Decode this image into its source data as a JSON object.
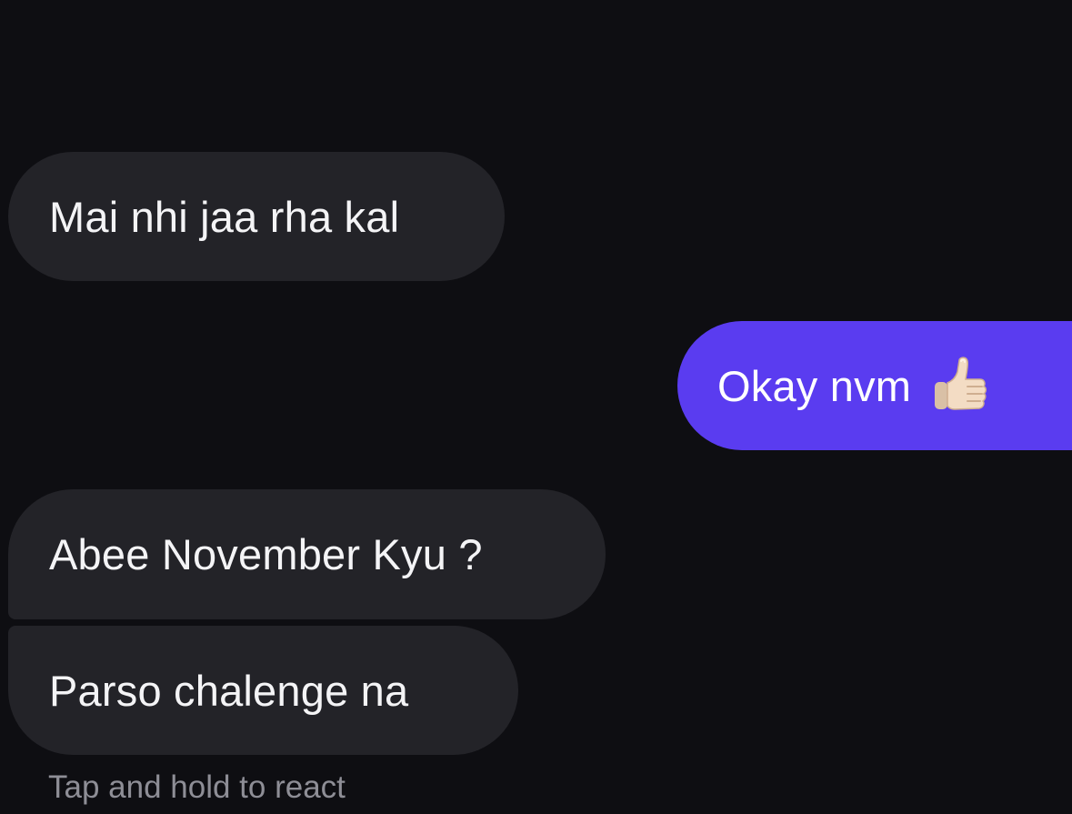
{
  "conversation": {
    "messages": [
      {
        "direction": "received",
        "text": "Mai nhi jaa rha kal"
      },
      {
        "direction": "sent",
        "text": "Okay nvm",
        "emoji": "thumbs-up-icon"
      },
      {
        "direction": "received",
        "text": "Abee November Kyu ?"
      },
      {
        "direction": "received",
        "text": "Parso chalenge na"
      }
    ],
    "hint": "Tap and hold to react"
  },
  "colors": {
    "background": "#0e0e12",
    "received_bubble": "#232328",
    "sent_bubble": "#5a3cf0",
    "hint_text": "#8e8e96"
  }
}
